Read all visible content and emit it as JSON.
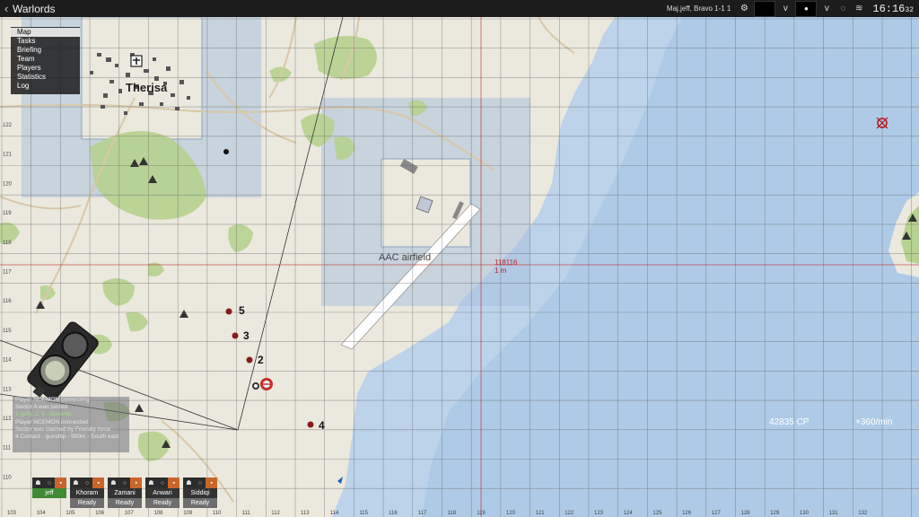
{
  "topbar": {
    "back_icon": "chevron-left-icon",
    "title": "Warlords",
    "player_info": "Maj.jeff, Bravo 1-1 1",
    "icons": [
      "gear-icon",
      "chevron-down-icon",
      "dot-icon",
      "chevron-down-icon",
      "loading-circle-icon",
      "layers-icon"
    ],
    "clock": "16:16",
    "clock_seconds": "32"
  },
  "menu": {
    "items": [
      {
        "label": "Map",
        "active": true
      },
      {
        "label": "Tasks"
      },
      {
        "label": "Briefing"
      },
      {
        "label": "Team"
      },
      {
        "label": "Players"
      },
      {
        "label": "Statistics"
      },
      {
        "label": "Log"
      }
    ]
  },
  "map": {
    "town_name": "Therisa",
    "airfield_name": "AAC airfield",
    "cursor_grid": "118116",
    "cursor_distance": "1 m",
    "cp": "42835 CP",
    "cp_rate": "+360/min",
    "waypoints": [
      "5",
      "3",
      "2",
      "4"
    ],
    "colors": {
      "land": "#ebe8dd",
      "sea": "#bcd3ea",
      "sector": "#a9c1dd",
      "forest": "#b6d28f",
      "cursor_line": "#c0302a",
      "grid": "#5a5a5a"
    },
    "grid_labels_bottom": [
      "103",
      "104",
      "105",
      "106",
      "107",
      "108",
      "109",
      "110",
      "111",
      "112",
      "113",
      "114",
      "115",
      "116",
      "117",
      "118",
      "119",
      "120",
      "121",
      "122",
      "123",
      "124",
      "125",
      "126",
      "127",
      "128",
      "129",
      "130",
      "131",
      "132"
    ],
    "grid_labels_left": [
      "122",
      "121",
      "120",
      "119",
      "118",
      "117",
      "116",
      "115",
      "114",
      "113",
      "112",
      "111",
      "110"
    ]
  },
  "chat_log": [
    {
      "text": "Player NCEMON connecting",
      "color": "#e6e6e6"
    },
    {
      "text": "Sector A was seized",
      "color": "#e6e6e6"
    },
    {
      "text": "1 (jeff): 2, 5 - Gunship",
      "color": "#9fe07a"
    },
    {
      "text": "Player NCEMON connected",
      "color": "#e6e6e6"
    },
    {
      "text": "Sector was claimed by Friendly force",
      "color": "#e6e6e6"
    },
    {
      "text": "4 Contact - gunship - 900m - South east",
      "color": "#e6e6e6"
    }
  ],
  "squad": [
    {
      "name": "jeff",
      "status": "",
      "leader": true
    },
    {
      "name": "Khoram",
      "status": "Ready"
    },
    {
      "name": "Zamani",
      "status": "Ready"
    },
    {
      "name": "Anwari",
      "status": "Ready"
    },
    {
      "name": "Siddiqi",
      "status": "Ready"
    }
  ]
}
